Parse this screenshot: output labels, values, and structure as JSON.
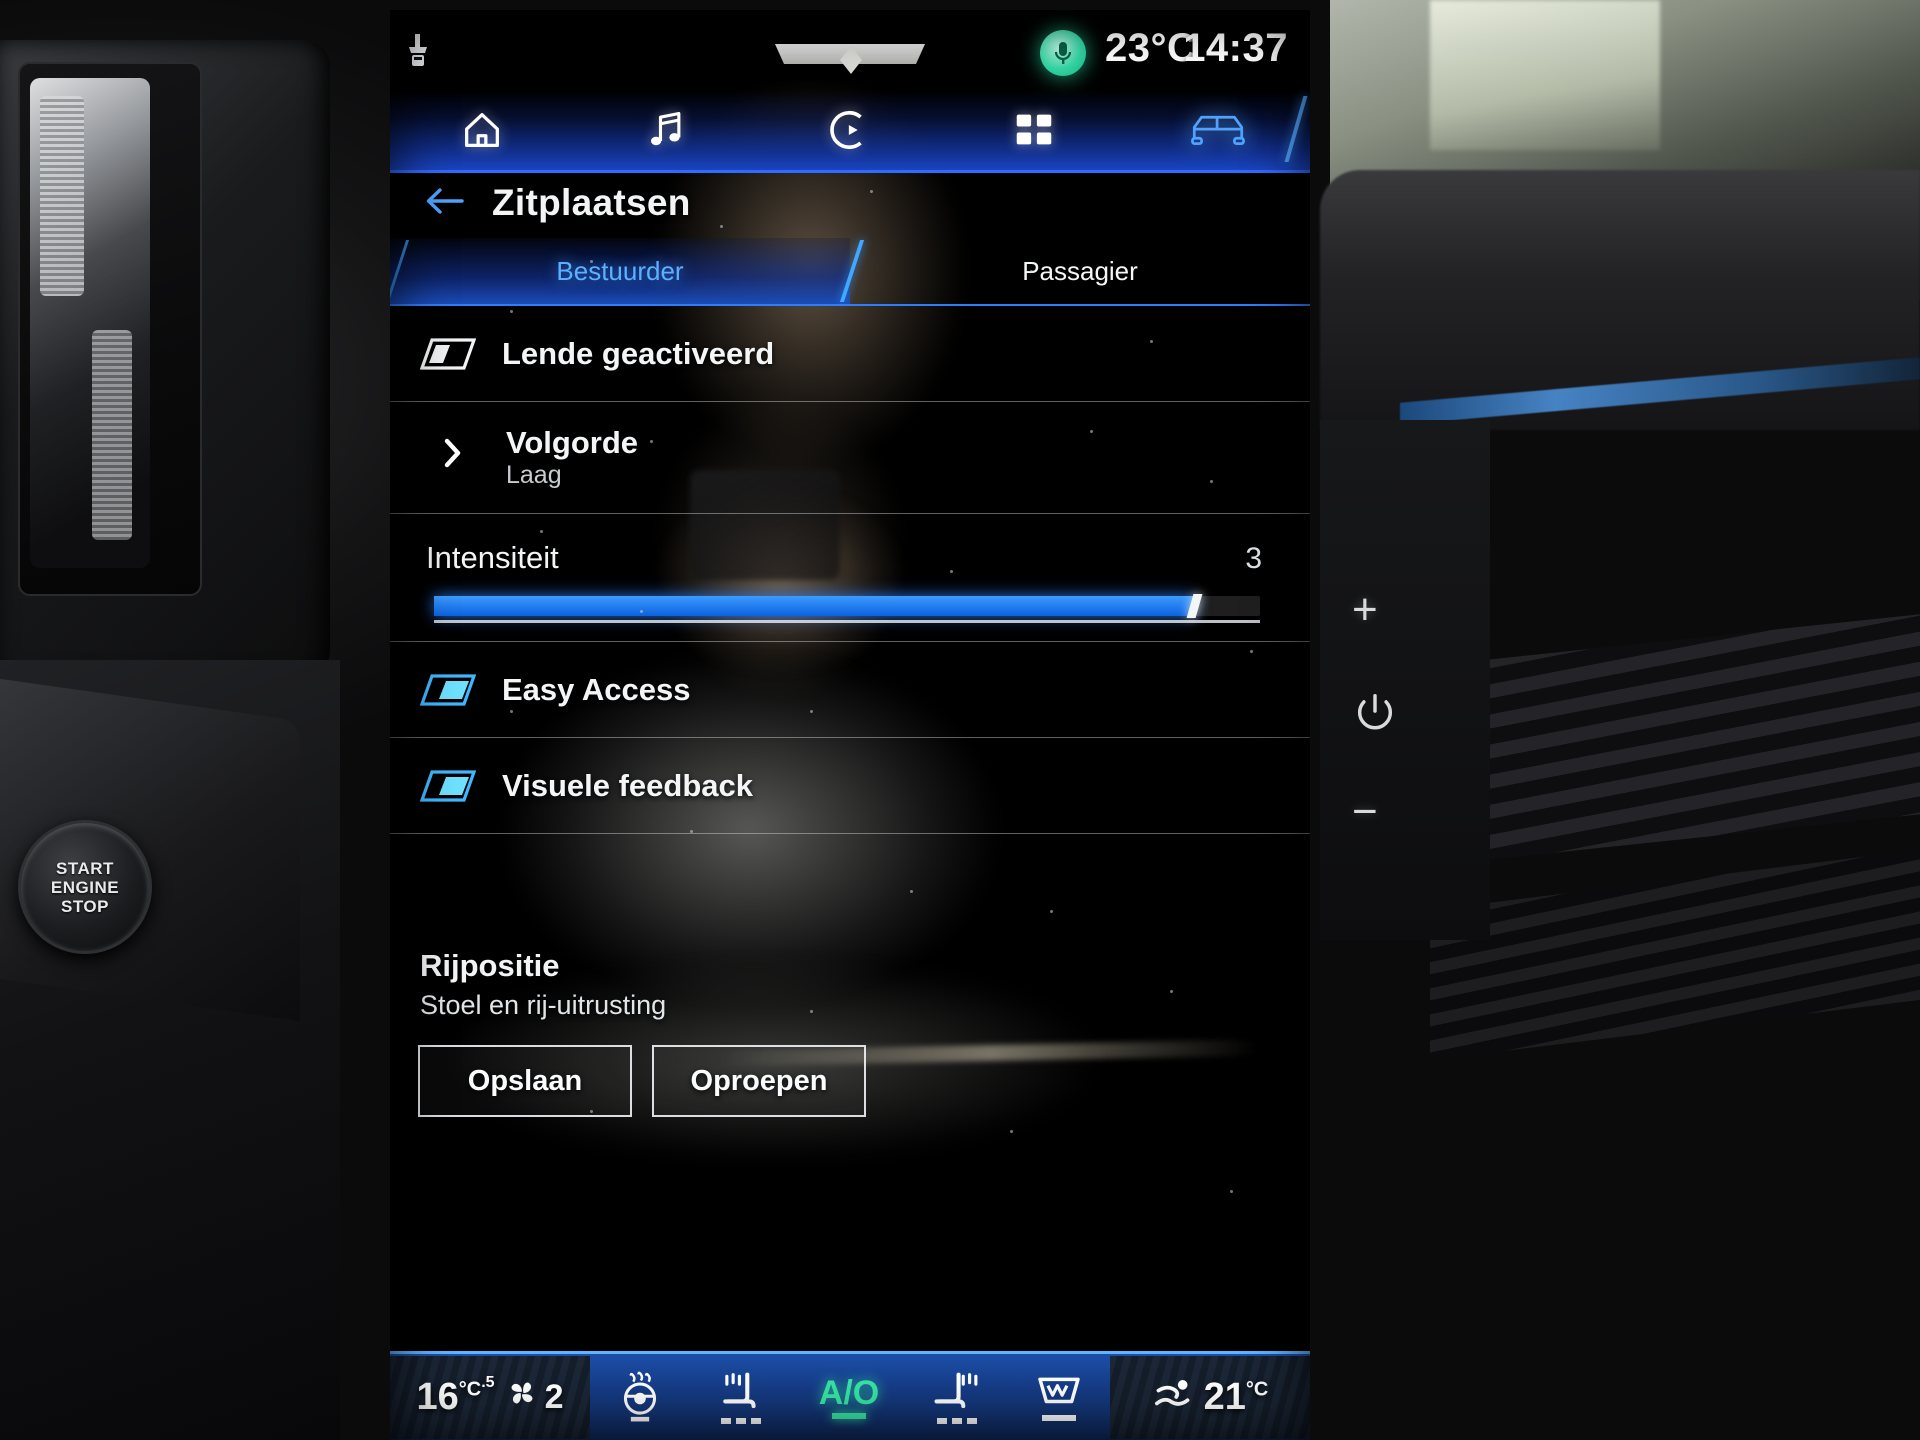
{
  "status_bar": {
    "temperature": "23°C",
    "time": "14:37",
    "mic_icon": "microphone-icon",
    "hook_icon": "tow-hook-icon"
  },
  "nav_bar": {
    "items": [
      {
        "icon": "home-icon",
        "name": "nav-home",
        "active": false
      },
      {
        "icon": "music-note-icon",
        "name": "nav-media",
        "active": false
      },
      {
        "icon": "phone-connect-icon",
        "name": "nav-phone",
        "active": false
      },
      {
        "icon": "apps-grid-icon",
        "name": "nav-apps",
        "active": false
      },
      {
        "icon": "car-icon",
        "name": "nav-vehicle",
        "active": true
      }
    ]
  },
  "header": {
    "back_icon": "back-arrow-icon",
    "title": "Zitplaatsen"
  },
  "tabs": [
    {
      "label": "Bestuurder",
      "active": true
    },
    {
      "label": "Passagier",
      "active": false
    }
  ],
  "settings": {
    "lumbar": {
      "label": "Lende geactiveerd",
      "toggle_state": "off",
      "icon": "toggle-switch-icon"
    },
    "volgorde": {
      "label": "Volgorde",
      "value": "Laag",
      "icon": "chevron-right-icon"
    },
    "intensiteit": {
      "label": "Intensiteit",
      "value": "3",
      "fill_percent": 92
    },
    "easy_access": {
      "label": "Easy Access",
      "toggle_state": "on",
      "icon": "toggle-switch-icon"
    },
    "visuele_feedback": {
      "label": "Visuele feedback",
      "toggle_state": "on",
      "icon": "toggle-switch-icon"
    }
  },
  "drive_position": {
    "title": "Rijpositie",
    "subtitle": "Stoel en rij-uitrusting",
    "save_label": "Opslaan",
    "recall_label": "Oproepen"
  },
  "climate_bar": {
    "left_temp": "16",
    "left_temp_unit": "°C",
    "left_temp_half": ".5",
    "fan_icon": "fan-icon",
    "fan_speed": "2",
    "steering_wheel_heat_icon": "steering-wheel-heat-icon",
    "seat_heat_icon": "seat-heat-icon",
    "auto_label": "A/O",
    "seat_back_heat_icon": "seat-back-heat-icon",
    "rear_defrost_icon": "rear-defrost-icon",
    "air_direction_icon": "air-direction-icon",
    "right_temp": "21",
    "right_temp_unit": "°C"
  },
  "hardware": {
    "plus_label": "+",
    "power_icon": "power-icon",
    "minus_label": "−",
    "start_button_line1": "START",
    "start_button_line2": "ENGINE",
    "start_button_line3": "STOP"
  },
  "colors": {
    "accent_blue": "#2f7dff",
    "active_tab_text": "#5cb0ff",
    "mic_green": "#35d6a4",
    "auto_green": "#38e3a4",
    "slider_fill": "#3d9bff"
  }
}
